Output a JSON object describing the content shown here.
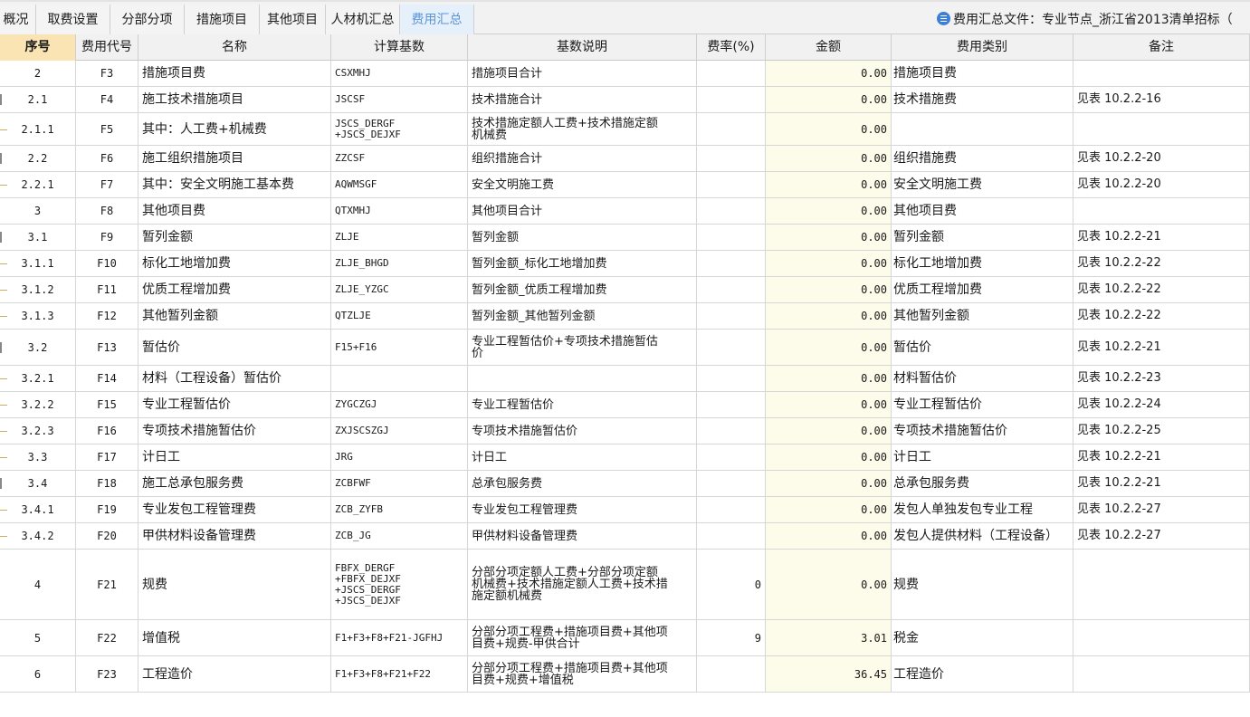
{
  "tabs": [
    {
      "label": "概况",
      "active": false
    },
    {
      "label": "取费设置",
      "active": false
    },
    {
      "label": "分部分项",
      "active": false
    },
    {
      "label": "措施项目",
      "active": false
    },
    {
      "label": "其他项目",
      "active": false
    },
    {
      "label": "人材机汇总",
      "active": false
    },
    {
      "label": "费用汇总",
      "active": true
    }
  ],
  "file_info": {
    "text": "费用汇总文件：专业节点_浙江省2013清单招标（",
    "icon": "list-document-icon"
  },
  "table": {
    "headers": [
      "序号",
      "费用代号",
      "名称",
      "计算基数",
      "基数说明",
      "费率(%)",
      "金额",
      "费用类别",
      "备注"
    ],
    "rows": [
      {
        "seq": "2",
        "code": "F3",
        "name": "措施项目费",
        "base": "CSXMHJ",
        "desc": "措施项目合计",
        "rate": "",
        "amount": "0.00",
        "type": "措施项目费",
        "note": "",
        "marker": "none"
      },
      {
        "seq": "2.1",
        "code": "F4",
        "name": "施工技术措施项目",
        "base": "JSCSF",
        "desc": "技术措施合计",
        "rate": "",
        "amount": "0.00",
        "type": "技术措施费",
        "note": "见表 10.2.2-16",
        "marker": "bar"
      },
      {
        "seq": "2.1.1",
        "code": "F5",
        "name": "其中：人工费+机械费",
        "base": "JSCS_DERGF\n+JSCS_DEJXF",
        "desc": "技术措施定额人工费+技术措施定额\n机械费",
        "rate": "",
        "amount": "0.00",
        "type": "",
        "note": "",
        "marker": "dash"
      },
      {
        "seq": "2.2",
        "code": "F6",
        "name": "施工组织措施项目",
        "base": "ZZCSF",
        "desc": "组织措施合计",
        "rate": "",
        "amount": "0.00",
        "type": "组织措施费",
        "note": "见表 10.2.2-20",
        "marker": "bar"
      },
      {
        "seq": "2.2.1",
        "code": "F7",
        "name": "其中：安全文明施工基本费",
        "base": "AQWMSGF",
        "desc": "安全文明施工费",
        "rate": "",
        "amount": "0.00",
        "type": "安全文明施工费",
        "note": "见表 10.2.2-20",
        "marker": "dash"
      },
      {
        "seq": "3",
        "code": "F8",
        "name": "其他项目费",
        "base": "QTXMHJ",
        "desc": "其他项目合计",
        "rate": "",
        "amount": "0.00",
        "type": "其他项目费",
        "note": "",
        "marker": "none"
      },
      {
        "seq": "3.1",
        "code": "F9",
        "name": "暂列金额",
        "base": "ZLJE",
        "desc": "暂列金额",
        "rate": "",
        "amount": "0.00",
        "type": "暂列金额",
        "note": "见表 10.2.2-21",
        "marker": "bar"
      },
      {
        "seq": "3.1.1",
        "code": "F10",
        "name": "标化工地增加费",
        "base": "ZLJE_BHGD",
        "desc": "暂列金额_标化工地增加费",
        "rate": "",
        "amount": "0.00",
        "type": "标化工地增加费",
        "note": "见表 10.2.2-22",
        "marker": "dash"
      },
      {
        "seq": "3.1.2",
        "code": "F11",
        "name": "优质工程增加费",
        "base": "ZLJE_YZGC",
        "desc": "暂列金额_优质工程增加费",
        "rate": "",
        "amount": "0.00",
        "type": "优质工程增加费",
        "note": "见表 10.2.2-22",
        "marker": "dash"
      },
      {
        "seq": "3.1.3",
        "code": "F12",
        "name": "其他暂列金额",
        "base": "QTZLJE",
        "desc": "暂列金额_其他暂列金额",
        "rate": "",
        "amount": "0.00",
        "type": "其他暂列金额",
        "note": "见表 10.2.2-22",
        "marker": "dash"
      },
      {
        "seq": "3.2",
        "code": "F13",
        "name": "暂估价",
        "base": "F15+F16",
        "desc": "专业工程暂估价+专项技术措施暂估\n价",
        "rate": "",
        "amount": "0.00",
        "type": "暂估价",
        "note": "见表 10.2.2-21",
        "marker": "bar"
      },
      {
        "seq": "3.2.1",
        "code": "F14",
        "name": "材料（工程设备）暂估价",
        "base": "",
        "desc": "",
        "rate": "",
        "amount": "0.00",
        "type": "材料暂估价",
        "note": "见表 10.2.2-23",
        "marker": "dash"
      },
      {
        "seq": "3.2.2",
        "code": "F15",
        "name": "专业工程暂估价",
        "base": "ZYGCZGJ",
        "desc": "专业工程暂估价",
        "rate": "",
        "amount": "0.00",
        "type": "专业工程暂估价",
        "note": "见表 10.2.2-24",
        "marker": "dash"
      },
      {
        "seq": "3.2.3",
        "code": "F16",
        "name": "专项技术措施暂估价",
        "base": "ZXJSCSZGJ",
        "desc": "专项技术措施暂估价",
        "rate": "",
        "amount": "0.00",
        "type": "专项技术措施暂估价",
        "note": "见表 10.2.2-25",
        "marker": "dash"
      },
      {
        "seq": "3.3",
        "code": "F17",
        "name": "计日工",
        "base": "JRG",
        "desc": "计日工",
        "rate": "",
        "amount": "0.00",
        "type": "计日工",
        "note": "见表 10.2.2-21",
        "marker": "dash"
      },
      {
        "seq": "3.4",
        "code": "F18",
        "name": "施工总承包服务费",
        "base": "ZCBFWF",
        "desc": "总承包服务费",
        "rate": "",
        "amount": "0.00",
        "type": "总承包服务费",
        "note": "见表 10.2.2-21",
        "marker": "bar"
      },
      {
        "seq": "3.4.1",
        "code": "F19",
        "name": "专业发包工程管理费",
        "base": "ZCB_ZYFB",
        "desc": "专业发包工程管理费",
        "rate": "",
        "amount": "0.00",
        "type": "发包人单独发包专业工程",
        "note": "见表 10.2.2-27",
        "marker": "dash"
      },
      {
        "seq": "3.4.2",
        "code": "F20",
        "name": "甲供材料设备管理费",
        "base": "ZCB_JG",
        "desc": "甲供材料设备管理费",
        "rate": "",
        "amount": "0.00",
        "type": "发包人提供材料（工程设备）",
        "note": "见表 10.2.2-27",
        "marker": "dash"
      },
      {
        "seq": "4",
        "code": "F21",
        "name": "规费",
        "base": "FBFX_DERGF\n+FBFX_DEJXF\n+JSCS_DERGF\n+JSCS_DEJXF",
        "desc": "分部分项定额人工费+分部分项定额\n机械费+技术措施定额人工费+技术措\n施定额机械费",
        "rate": "0",
        "amount": "0.00",
        "type": "规费",
        "note": "",
        "marker": "none"
      },
      {
        "seq": "5",
        "code": "F22",
        "name": "增值税",
        "base": "F1+F3+F8+F21-JGFHJ",
        "desc": "分部分项工程费+措施项目费+其他项\n目费+规费-甲供合计",
        "rate": "9",
        "amount": "3.01",
        "type": "税金",
        "note": "",
        "marker": "none"
      },
      {
        "seq": "6",
        "code": "F23",
        "name": "工程造价",
        "base": "F1+F3+F8+F21+F22",
        "desc": "分部分项工程费+措施项目费+其他项\n目费+规费+增值税",
        "rate": "",
        "amount": "36.45",
        "type": "工程造价",
        "note": "",
        "marker": "none"
      }
    ]
  }
}
